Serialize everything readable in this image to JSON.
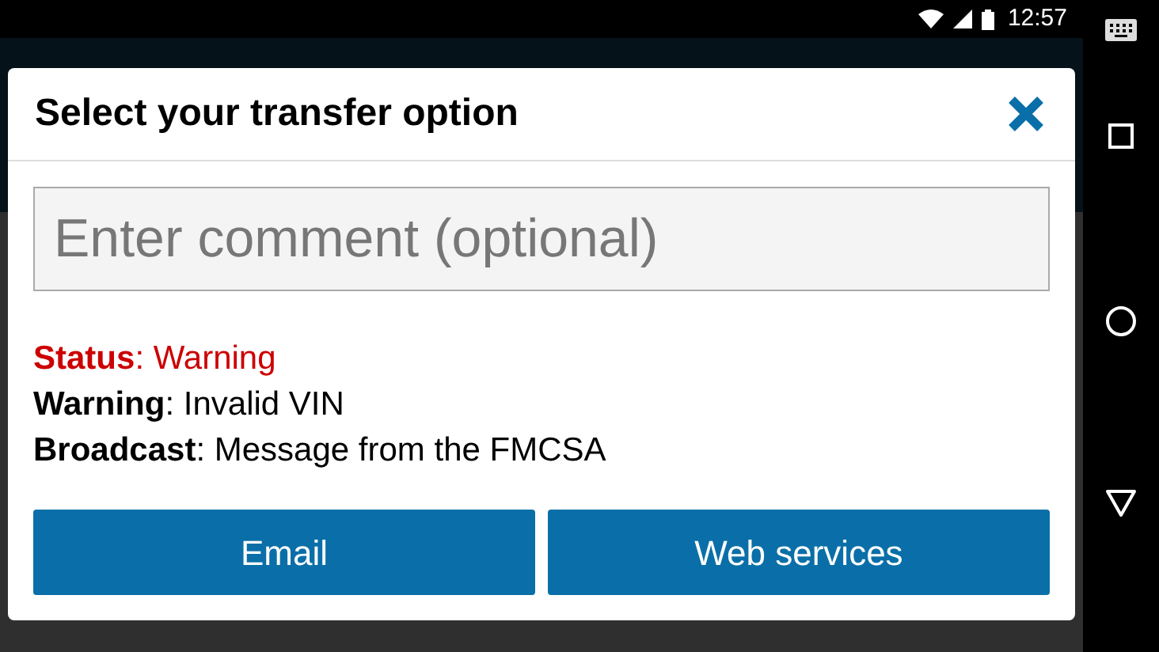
{
  "status_bar": {
    "time": "12:57"
  },
  "dialog": {
    "title": "Select your transfer option",
    "comment": {
      "placeholder": "Enter comment (optional)"
    },
    "info_lines": [
      {
        "text": "**Status**: Warning",
        "kind": "alert"
      },
      {
        "text": "**Warning**: Invalid VIN",
        "kind": "plain"
      },
      {
        "text": "**Broadcast**: Message from the FMCSA",
        "kind": "plain"
      }
    ],
    "buttons": [
      "Email",
      "Web services"
    ]
  }
}
